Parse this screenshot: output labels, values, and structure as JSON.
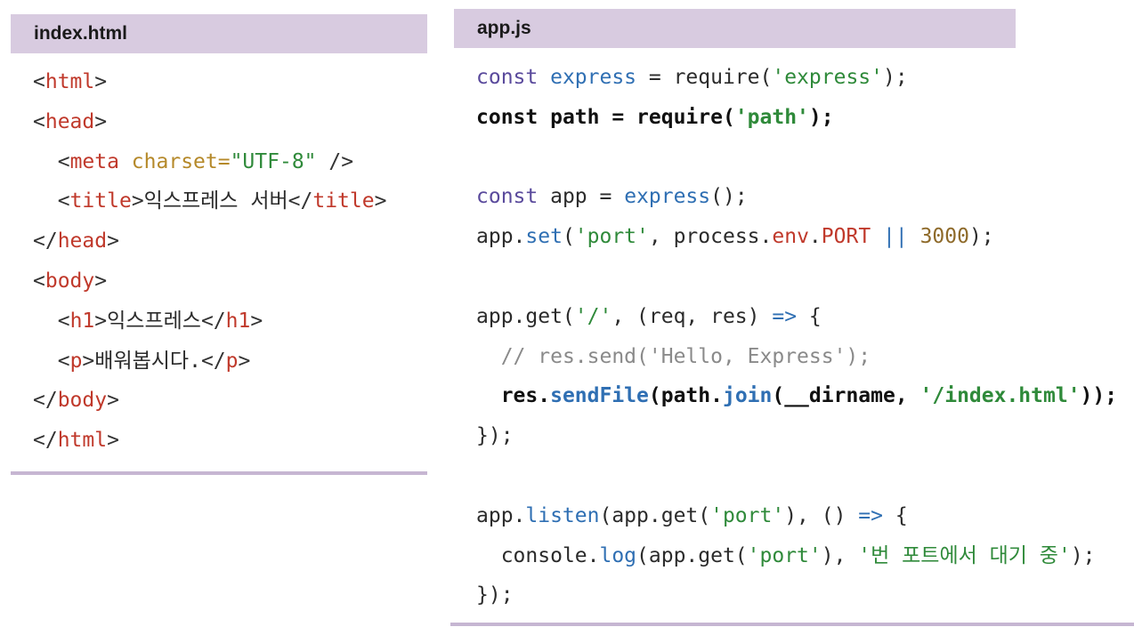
{
  "left_panel": {
    "title": "index.html",
    "lines": [
      {
        "indent": 0,
        "tokens": [
          {
            "t": "<",
            "c": "punc"
          },
          {
            "t": "html",
            "c": "tag"
          },
          {
            "t": ">",
            "c": "punc"
          }
        ]
      },
      {
        "indent": 0,
        "tokens": [
          {
            "t": "<",
            "c": "punc"
          },
          {
            "t": "head",
            "c": "tag"
          },
          {
            "t": ">",
            "c": "punc"
          }
        ]
      },
      {
        "indent": 1,
        "tokens": [
          {
            "t": "<",
            "c": "punc"
          },
          {
            "t": "meta",
            "c": "tag"
          },
          {
            "t": " charset=",
            "c": "attr"
          },
          {
            "t": "\"UTF-8\"",
            "c": "str"
          },
          {
            "t": " />",
            "c": "punc"
          }
        ]
      },
      {
        "indent": 1,
        "tokens": [
          {
            "t": "<",
            "c": "punc"
          },
          {
            "t": "title",
            "c": "tag"
          },
          {
            "t": ">",
            "c": "punc"
          },
          {
            "t": "익스프레스 서버",
            "c": "text"
          },
          {
            "t": "</",
            "c": "punc"
          },
          {
            "t": "title",
            "c": "tag"
          },
          {
            "t": ">",
            "c": "punc"
          }
        ]
      },
      {
        "indent": 0,
        "tokens": [
          {
            "t": "</",
            "c": "punc"
          },
          {
            "t": "head",
            "c": "tag"
          },
          {
            "t": ">",
            "c": "punc"
          }
        ]
      },
      {
        "indent": 0,
        "tokens": [
          {
            "t": "<",
            "c": "punc"
          },
          {
            "t": "body",
            "c": "tag"
          },
          {
            "t": ">",
            "c": "punc"
          }
        ]
      },
      {
        "indent": 1,
        "tokens": [
          {
            "t": "<",
            "c": "punc"
          },
          {
            "t": "h1",
            "c": "tag"
          },
          {
            "t": ">",
            "c": "punc"
          },
          {
            "t": "익스프레스",
            "c": "text"
          },
          {
            "t": "</",
            "c": "punc"
          },
          {
            "t": "h1",
            "c": "tag"
          },
          {
            "t": ">",
            "c": "punc"
          }
        ]
      },
      {
        "indent": 1,
        "tokens": [
          {
            "t": "<",
            "c": "punc"
          },
          {
            "t": "p",
            "c": "tag"
          },
          {
            "t": ">",
            "c": "punc"
          },
          {
            "t": "배워봅시다.",
            "c": "text"
          },
          {
            "t": "</",
            "c": "punc"
          },
          {
            "t": "p",
            "c": "tag"
          },
          {
            "t": ">",
            "c": "punc"
          }
        ]
      },
      {
        "indent": 0,
        "tokens": [
          {
            "t": "</",
            "c": "punc"
          },
          {
            "t": "body",
            "c": "tag"
          },
          {
            "t": ">",
            "c": "punc"
          }
        ]
      },
      {
        "indent": 0,
        "tokens": [
          {
            "t": "</",
            "c": "punc"
          },
          {
            "t": "html",
            "c": "tag"
          },
          {
            "t": ">",
            "c": "punc"
          }
        ]
      }
    ]
  },
  "right_panel": {
    "title": "app.js",
    "lines": [
      {
        "indent": 0,
        "tokens": [
          {
            "t": "const",
            "c": "kw"
          },
          {
            "t": " express",
            "c": "fn"
          },
          {
            "t": " = require(",
            "c": "plain"
          },
          {
            "t": "'express'",
            "c": "str"
          },
          {
            "t": ");",
            "c": "plain"
          }
        ]
      },
      {
        "indent": 0,
        "bold": true,
        "tokens": [
          {
            "t": "const",
            "c": "kw"
          },
          {
            "t": " path = require(",
            "c": "plain"
          },
          {
            "t": "'path'",
            "c": "str"
          },
          {
            "t": ");",
            "c": "plain"
          }
        ]
      },
      {
        "indent": 0,
        "tokens": []
      },
      {
        "indent": 0,
        "tokens": [
          {
            "t": "const",
            "c": "kw"
          },
          {
            "t": " app = ",
            "c": "plain"
          },
          {
            "t": "express",
            "c": "fn"
          },
          {
            "t": "();",
            "c": "plain"
          }
        ]
      },
      {
        "indent": 0,
        "tokens": [
          {
            "t": "app.",
            "c": "plain"
          },
          {
            "t": "set",
            "c": "fn"
          },
          {
            "t": "(",
            "c": "plain"
          },
          {
            "t": "'port'",
            "c": "str"
          },
          {
            "t": ", process.",
            "c": "plain"
          },
          {
            "t": "env",
            "c": "prop"
          },
          {
            "t": ".",
            "c": "plain"
          },
          {
            "t": "PORT",
            "c": "prop"
          },
          {
            "t": " || ",
            "c": "op"
          },
          {
            "t": "3000",
            "c": "num"
          },
          {
            "t": ");",
            "c": "plain"
          }
        ]
      },
      {
        "indent": 0,
        "tokens": []
      },
      {
        "indent": 0,
        "tokens": [
          {
            "t": "app.get(",
            "c": "plain"
          },
          {
            "t": "'/'",
            "c": "str"
          },
          {
            "t": ", (req, res) ",
            "c": "plain"
          },
          {
            "t": "=>",
            "c": "op"
          },
          {
            "t": " {",
            "c": "plain"
          }
        ]
      },
      {
        "indent": 1,
        "tokens": [
          {
            "t": "// res.send('Hello, Express');",
            "c": "comment"
          }
        ]
      },
      {
        "indent": 1,
        "bold": true,
        "tokens": [
          {
            "t": "res.",
            "c": "plain"
          },
          {
            "t": "sendFile",
            "c": "fn"
          },
          {
            "t": "(path.",
            "c": "plain"
          },
          {
            "t": "join",
            "c": "fn"
          },
          {
            "t": "(__dirname, ",
            "c": "plain"
          },
          {
            "t": "'/index.html'",
            "c": "str"
          },
          {
            "t": "));",
            "c": "plain"
          }
        ]
      },
      {
        "indent": 0,
        "tokens": [
          {
            "t": "});",
            "c": "plain"
          }
        ]
      },
      {
        "indent": 0,
        "tokens": []
      },
      {
        "indent": 0,
        "tokens": [
          {
            "t": "app.",
            "c": "plain"
          },
          {
            "t": "listen",
            "c": "fn"
          },
          {
            "t": "(app.get(",
            "c": "plain"
          },
          {
            "t": "'port'",
            "c": "str"
          },
          {
            "t": "), () ",
            "c": "plain"
          },
          {
            "t": "=>",
            "c": "op"
          },
          {
            "t": " {",
            "c": "plain"
          }
        ]
      },
      {
        "indent": 1,
        "tokens": [
          {
            "t": "console.",
            "c": "plain"
          },
          {
            "t": "log",
            "c": "fn"
          },
          {
            "t": "(app.get(",
            "c": "plain"
          },
          {
            "t": "'port'",
            "c": "str"
          },
          {
            "t": "), ",
            "c": "plain"
          },
          {
            "t": "'번 포트에서 대기 중'",
            "c": "str"
          },
          {
            "t": ");",
            "c": "plain"
          }
        ]
      },
      {
        "indent": 0,
        "tokens": [
          {
            "t": "});",
            "c": "plain"
          }
        ]
      }
    ]
  }
}
